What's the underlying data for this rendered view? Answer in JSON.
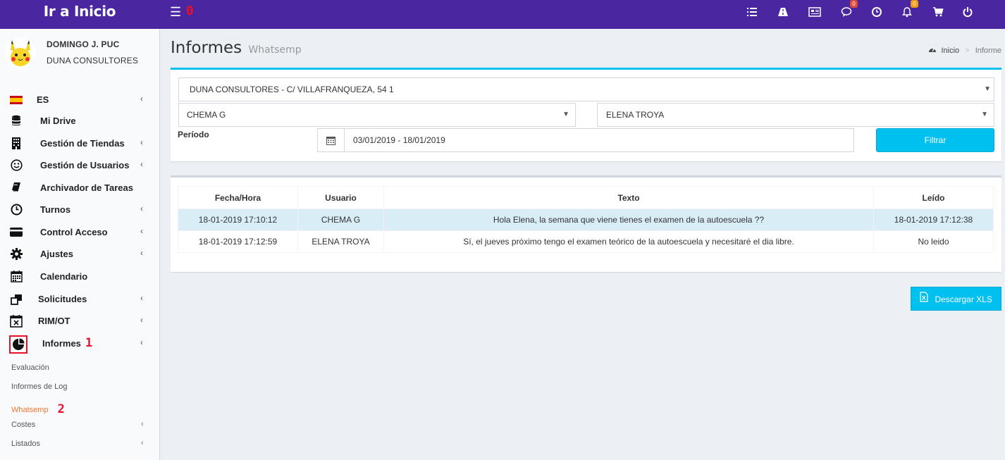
{
  "header": {
    "brand": "Ir a Inicio",
    "menu_icon": "hamburger-icon",
    "annotation0": "0",
    "icons": [
      {
        "name": "list-icon"
      },
      {
        "name": "road-icon"
      },
      {
        "name": "newspaper-icon"
      },
      {
        "name": "comments-icon",
        "badge": "0",
        "badge_color": "#dd4b39"
      },
      {
        "name": "clock-icon"
      },
      {
        "name": "bell-icon",
        "badge": "0",
        "badge_color": "#f39c12"
      },
      {
        "name": "cart-icon"
      },
      {
        "name": "power-icon"
      }
    ]
  },
  "user": {
    "name": "DOMINGO J. PUC",
    "company": "DUNA CONSULTORES"
  },
  "sidebar": {
    "items": [
      {
        "label": "ES"
      },
      {
        "label": "Mi Drive"
      },
      {
        "label": "Gestión de Tiendas"
      },
      {
        "label": "Gestión de Usuarios"
      },
      {
        "label": "Archivador de Tareas"
      },
      {
        "label": "Turnos"
      },
      {
        "label": "Control Acceso"
      },
      {
        "label": "Ajustes"
      },
      {
        "label": "Calendario"
      },
      {
        "label": "Solicitudes"
      },
      {
        "label": "RIM/OT"
      },
      {
        "label": "Informes"
      }
    ],
    "annotation1": "1",
    "subitems": [
      {
        "label": "Evaluación"
      },
      {
        "label": "Informes de Log"
      },
      {
        "label": "Whatsemp"
      },
      {
        "label": "Costes"
      },
      {
        "label": "Listados"
      }
    ],
    "annotation2": "2",
    "active_color": "#f0772e"
  },
  "page": {
    "title": "Informes",
    "subtitle": "Whatsemp",
    "breadcrumb": {
      "home": "Inicio",
      "current": "Informe"
    }
  },
  "filters": {
    "store": "DUNA CONSULTORES - C/ VILLAFRANQUEZA, 54 1",
    "user1": "CHEMA G",
    "user2": "ELENA TROYA",
    "period_label": "Período",
    "period_value": "03/01/2019 - 18/01/2019",
    "filter_button": "Filtrar"
  },
  "table": {
    "headers": [
      "Fecha/Hora",
      "Usuario",
      "Texto",
      "Leído"
    ],
    "rows": [
      [
        "18-01-2019 17:10:12",
        "CHEMA G",
        "Hola Elena, la semana que viene tienes el examen de la autoescuela ??",
        "18-01-2019 17:12:38"
      ],
      [
        "18-01-2019 17:12:59",
        "ELENA TROYA",
        "Sí, el jueves próximo tengo el examen teórico de la autoescuela y necesitaré el dia libre.",
        "No leido"
      ]
    ]
  },
  "download_button": "Descargar XLS",
  "colors": {
    "topbar": "#4a26a0",
    "accent": "#00c0ef",
    "annotation": "#e8102a"
  }
}
